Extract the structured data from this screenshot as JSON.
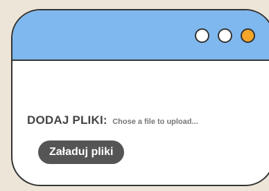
{
  "upload": {
    "label": "DODAJ PLIKI:",
    "file_placeholder": "Chose a file to upload...",
    "button_label": "Załaduj pliki"
  },
  "window_controls": [
    {
      "name": "control-dot-1",
      "color": "#ffffff"
    },
    {
      "name": "control-dot-2",
      "color": "#ffffff"
    },
    {
      "name": "control-dot-3",
      "color": "#f4a62a"
    }
  ],
  "colors": {
    "background": "#ede5d8",
    "titlebar": "#7fb8ee",
    "button": "#555555",
    "accent": "#f4a62a"
  }
}
